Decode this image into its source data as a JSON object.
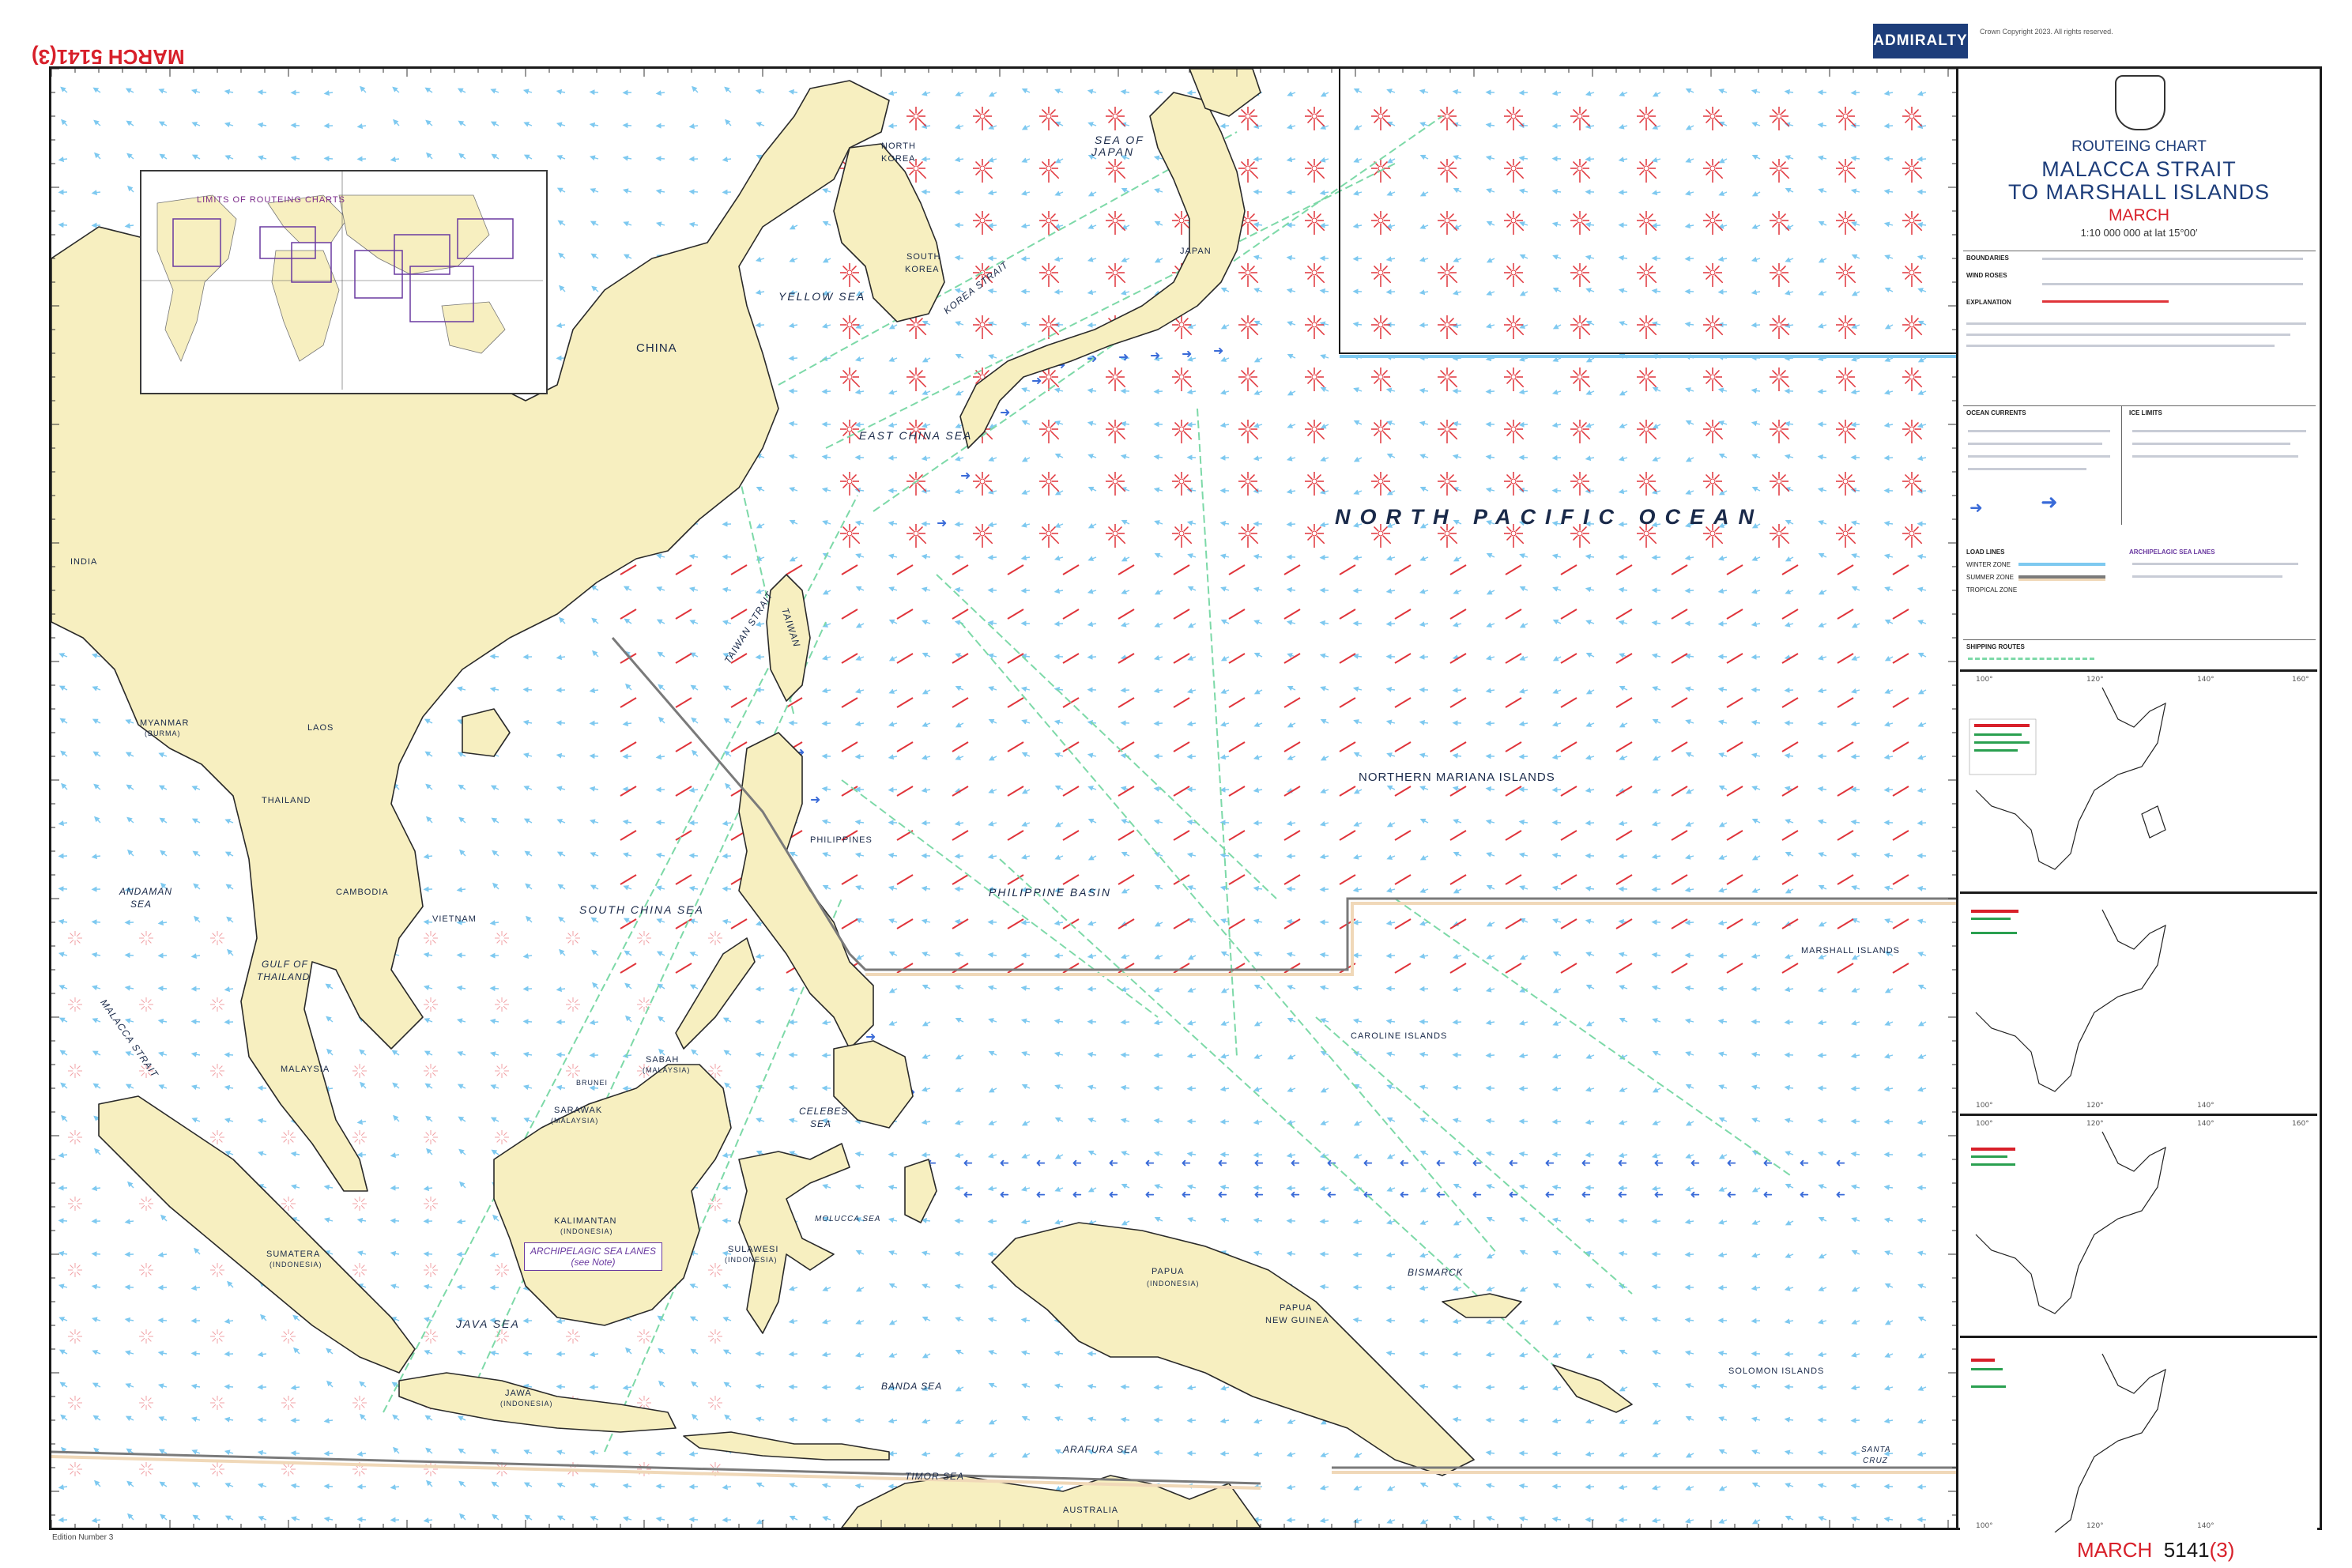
{
  "header": {
    "corner_label": "MARCH  5141(3)",
    "badge": "ADMIRALTY",
    "copyright_line": "Crown Copyright 2023. All rights reserved."
  },
  "title_block": {
    "kind": "ROUTEING CHART",
    "title_line1": "MALACCA STRAIT",
    "title_line2": "TO MARSHALL ISLANDS",
    "month": "MARCH",
    "scale": "1:10 000 000 at lat 15°00′"
  },
  "panel_sections": {
    "boundaries": "BOUNDARIES",
    "wind_roses": "WIND ROSES",
    "explanation": "EXPLANATION",
    "ocean_currents": "OCEAN CURRENTS",
    "ice_limits": "ICE LIMITS",
    "load_lines": "LOAD LINES",
    "winter_zone": "WINTER ZONE",
    "summer_zone": "SUMMER ZONE",
    "tropical_zone": "TROPICAL ZONE",
    "archipelagic": "ARCHIPELAGIC SEA LANES",
    "shipping_routes": "SHIPPING ROUTES"
  },
  "inset": {
    "title": "LIMITS OF ROUTEING CHARTS"
  },
  "map_labels": {
    "ocean": "NORTH PACIFIC OCEAN",
    "china": "CHINA",
    "japan": "JAPAN",
    "north_korea_1": "NORTH",
    "north_korea_2": "KOREA",
    "south_korea_1": "SOUTH",
    "south_korea_2": "KOREA",
    "sea_of_japan_1": "SEA OF",
    "sea_of_japan_2": "JAPAN",
    "yellow_sea": "YELLOW SEA",
    "korea_strait": "KOREA STRAIT",
    "east_china_sea": "EAST CHINA SEA",
    "taiwan_strait": "TAIWAN STRAIT",
    "taiwan": "TAIWAN",
    "india": "INDIA",
    "myanmar": "MYANMAR",
    "myanmar_sub": "(BURMA)",
    "laos": "LAOS",
    "thailand": "THAILAND",
    "cambodia": "CAMBODIA",
    "vietnam": "VIETNAM",
    "andaman_sea_1": "ANDAMAN",
    "andaman_sea_2": "SEA",
    "gulf_thailand_1": "GULF OF",
    "gulf_thailand_2": "THAILAND",
    "south_china_sea": "SOUTH CHINA SEA",
    "philippines": "PHILIPPINES",
    "philippine_basin": "PHILIPPINE BASIN",
    "n_mariana": "NORTHERN MARIANA ISLANDS",
    "malacca_strait": "MALACCA STRAIT",
    "malaysia": "MALAYSIA",
    "brunei": "BRUNEI",
    "sabah": "SABAH",
    "sabah_sub": "(MALAYSIA)",
    "sarawak": "SARAWAK",
    "sarawak_sub": "(MALAYSIA)",
    "celebes_sea_1": "CELEBES",
    "celebes_sea_2": "SEA",
    "kalimantan": "KALIMANTAN",
    "kalimantan_sub": "(INDONESIA)",
    "sumatera": "SUMATERA",
    "sumatera_sub": "(INDONESIA)",
    "sulawesi": "SULAWESI",
    "sulawesi_sub": "(INDONESIA)",
    "java_sea": "JAVA SEA",
    "jawa": "JAWA",
    "jawa_sub": "(INDONESIA)",
    "aspl_1": "ARCHIPELAGIC SEA LANES",
    "aspl_2": "(see Note)",
    "marshall": "MARSHALL ISLANDS",
    "caroline": "CAROLINE ISLANDS",
    "papua": "PAPUA",
    "papua_sub": "(INDONESIA)",
    "png_1": "PAPUA",
    "png_2": "NEW GUINEA",
    "solomon": "SOLOMON ISLANDS",
    "australia": "AUSTRALIA",
    "bismarck": "BISMARCK",
    "arafura": "ARAFURA SEA",
    "timor": "TIMOR SEA",
    "banda": "BANDA SEA",
    "molucca": "MOLUCCA SEA",
    "santa_cruz_1": "SANTA",
    "santa_cruz_2": "CRUZ"
  },
  "footer": {
    "month": "MARCH",
    "number": "5141",
    "edition": "(3)",
    "left_info": "Edition Number  3"
  },
  "colors": {
    "land": "#f7efc0",
    "coast": "#2a2a2a",
    "current_light": "#7ec9f0",
    "current_strong": "#3a6bd8",
    "wind": "#e0343a",
    "route": "#7dd9a8",
    "boundary": "#1a1a1a"
  }
}
